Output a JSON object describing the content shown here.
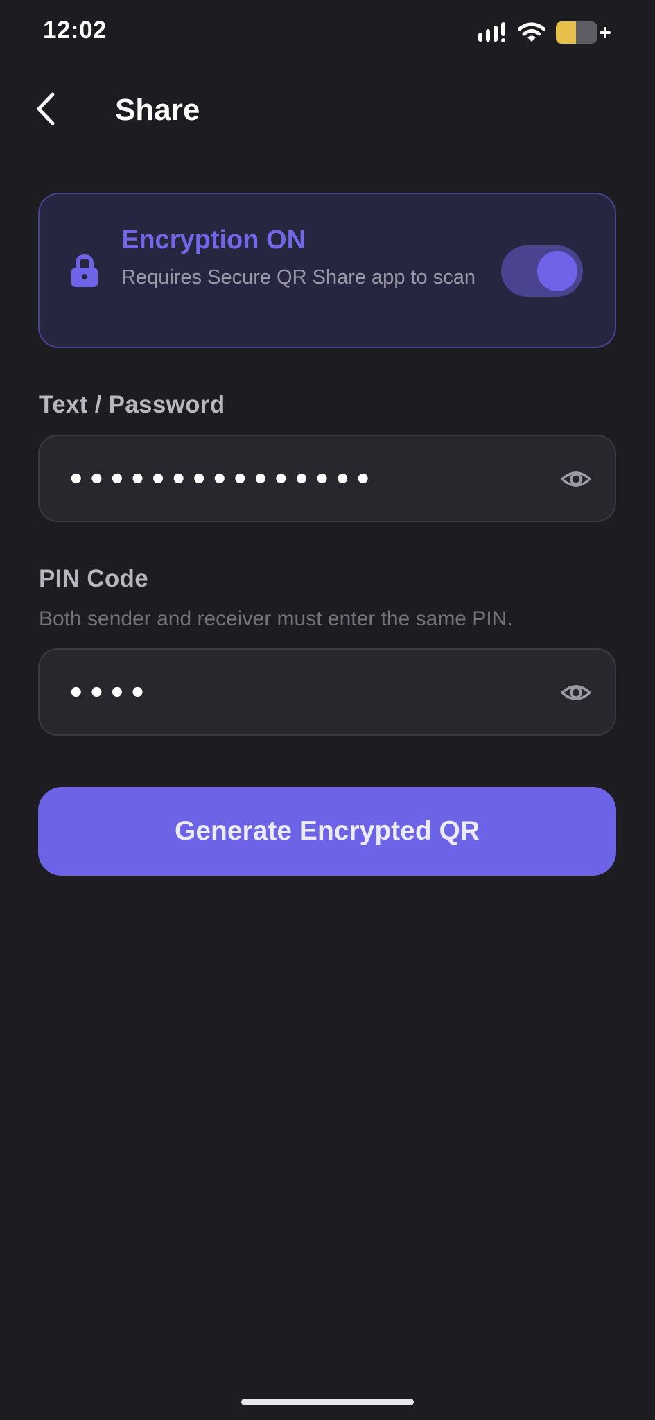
{
  "status_bar": {
    "time": "12:02",
    "icons": [
      "cellular-signal-icon",
      "wifi-icon",
      "battery-charging-icon"
    ],
    "battery_color": "#e5c04a"
  },
  "header": {
    "back_icon": "chevron-left-icon",
    "title": "Share"
  },
  "encryption": {
    "icon": "lock-icon",
    "title": "Encryption ON",
    "subtitle": "Requires Secure QR Share app to scan",
    "enabled": true,
    "accent_color": "#7268e6"
  },
  "text_field": {
    "label": "Text / Password",
    "masked_value": "•••••••••••••••",
    "visibility_icon": "eye-icon"
  },
  "pin_field": {
    "label": "PIN Code",
    "hint": "Both sender and receiver must enter the same PIN.",
    "masked_value": "••••",
    "visibility_icon": "eye-icon"
  },
  "primary_button": {
    "label": "Generate Encrypted QR",
    "color": "#6c63e6"
  },
  "theme": {
    "background": "#1d1c21",
    "card_background": "#262641",
    "field_background": "#28272d"
  }
}
